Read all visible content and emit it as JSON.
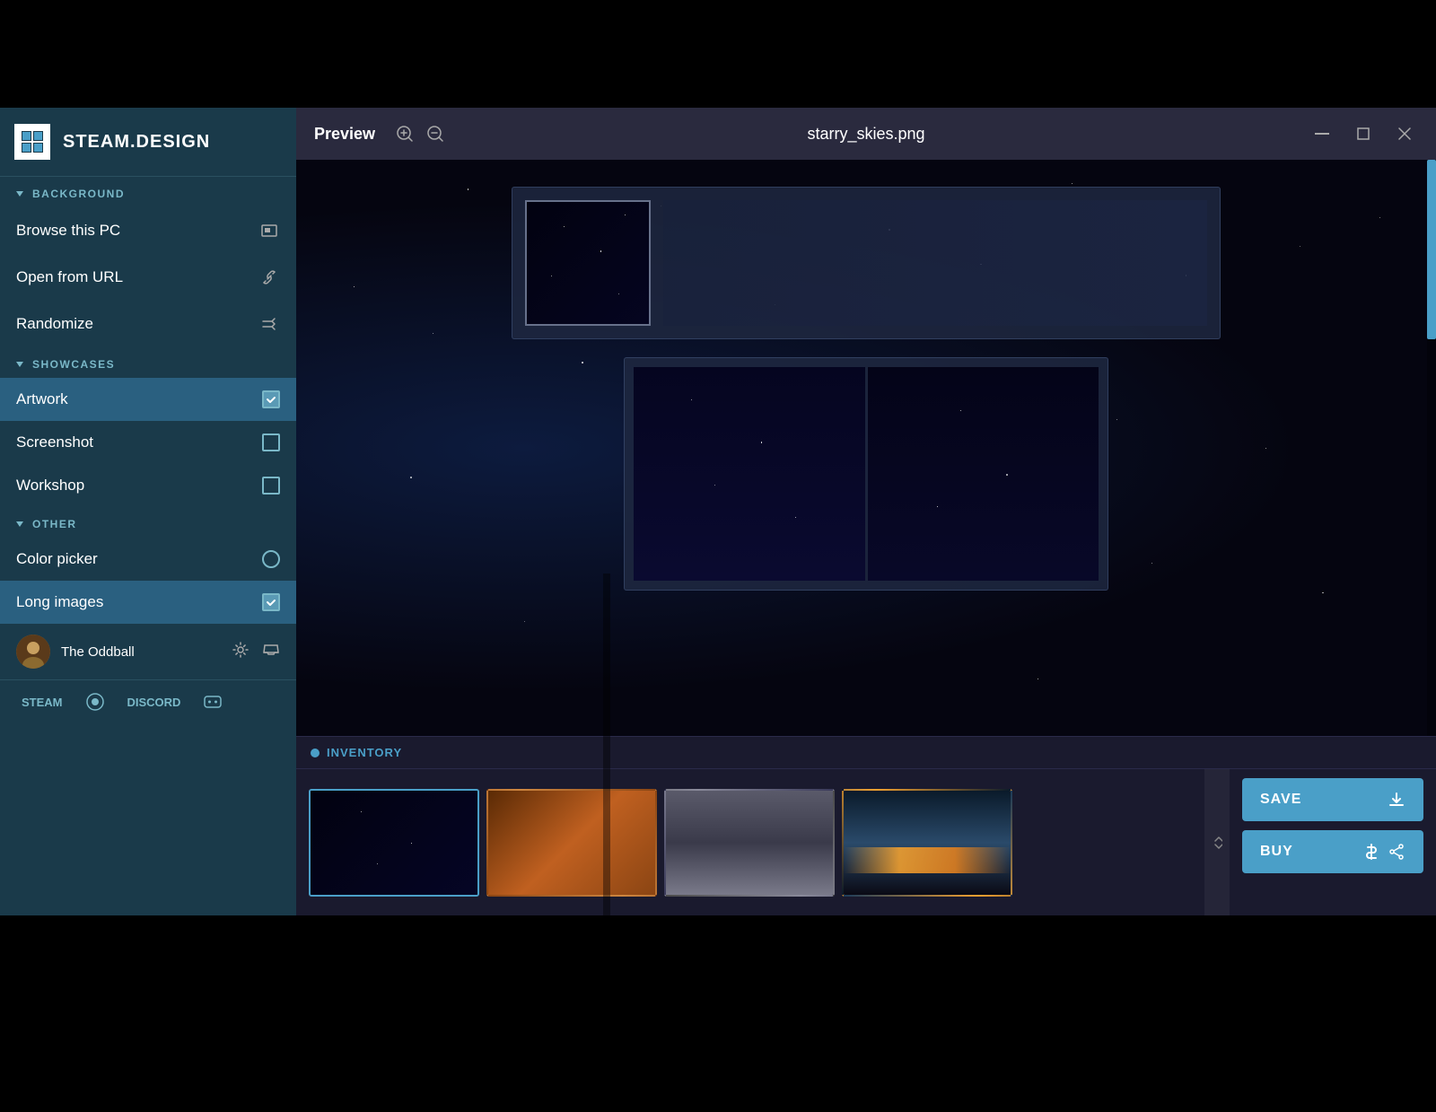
{
  "app": {
    "title": "STEAM.DESIGN"
  },
  "titlebar": {
    "preview_label": "Preview",
    "zoom_in_label": "+",
    "zoom_out_label": "−",
    "filename": "starry_skies.png",
    "minimize_label": "—",
    "maximize_label": "❐",
    "close_label": "✕"
  },
  "sidebar": {
    "background_section": "BACKGROUND",
    "browse_label": "Browse this PC",
    "open_url_label": "Open from URL",
    "randomize_label": "Randomize",
    "showcases_section": "SHOWCASES",
    "artwork_label": "Artwork",
    "screenshot_label": "Screenshot",
    "workshop_label": "Workshop",
    "other_section": "OTHER",
    "color_picker_label": "Color picker",
    "long_images_label": "Long images",
    "user_name": "The Oddball",
    "footer_steam": "STEAM",
    "footer_discord": "DISCORD"
  },
  "inventory": {
    "label": "INVENTORY"
  },
  "buttons": {
    "save_label": "SAVE",
    "buy_label": "BUY"
  },
  "thumbnails": [
    {
      "id": 1,
      "selected": true
    },
    {
      "id": 2,
      "selected": false
    },
    {
      "id": 3,
      "selected": false
    },
    {
      "id": 4,
      "selected": false
    }
  ]
}
